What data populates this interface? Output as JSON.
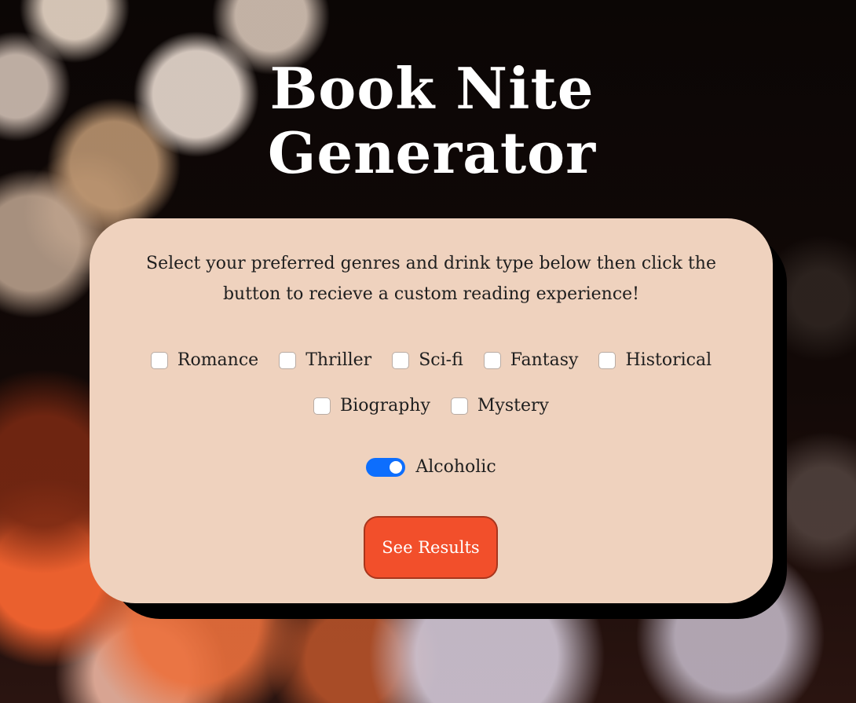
{
  "header": {
    "title_line1": "Book Nite",
    "title_line2": "Generator"
  },
  "form": {
    "instructions": "Select your preferred genres and drink type below then click the button to recieve a custom reading experience!",
    "genres": [
      {
        "label": "Romance",
        "checked": false
      },
      {
        "label": "Thriller",
        "checked": false
      },
      {
        "label": "Sci-fi",
        "checked": false
      },
      {
        "label": "Fantasy",
        "checked": false
      },
      {
        "label": "Historical",
        "checked": false
      },
      {
        "label": "Biography",
        "checked": false
      },
      {
        "label": "Mystery",
        "checked": false
      }
    ],
    "drink_toggle": {
      "label": "Alcoholic",
      "on": true
    },
    "submit_label": "See Results"
  },
  "colors": {
    "card_background": "#efd2be",
    "button_background": "#f24f2b",
    "toggle_on": "#0d6efd",
    "title_text": "#ffffff"
  }
}
